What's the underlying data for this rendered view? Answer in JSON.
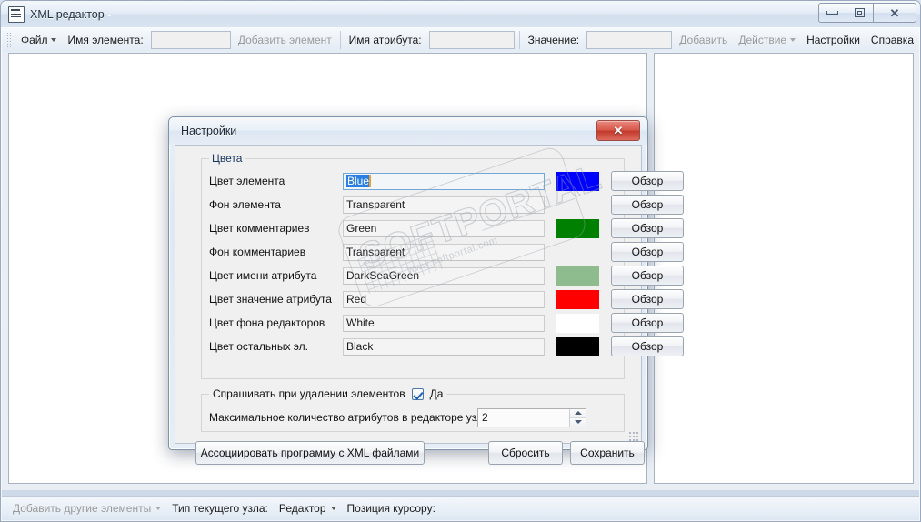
{
  "window": {
    "title": "XML редактор -",
    "icon": "xml-file-icon",
    "buttons": {
      "minimize": "minimize-icon",
      "maximize": "maximize-icon",
      "close": "✕"
    }
  },
  "toolbar": {
    "file_menu": "Файл",
    "element_name_label": "Имя элемента:",
    "element_name_value": "",
    "add_element": "Добавить элемент",
    "attribute_name_label": "Имя атрибута:",
    "attribute_name_value": "",
    "value_label": "Значение:",
    "value_value": "",
    "add": "Добавить",
    "action": "Действие",
    "settings": "Настройки",
    "help": "Справка"
  },
  "statusbar": {
    "add_other_elements": "Добавить другие элементы",
    "current_node_type_label": "Тип текущего узла:",
    "editor": "Редактор",
    "cursor_position_label": "Позиция курсору:"
  },
  "dialog": {
    "title": "Настройки",
    "close_label": "✕",
    "colors_group_legend": "Цвета",
    "browse_label": "Обзор",
    "rows": [
      {
        "label": "Цвет элемента",
        "value": "Blue",
        "swatch": "#0000ff",
        "transparent": false,
        "focused": true
      },
      {
        "label": "Фон элемента",
        "value": "Transparent",
        "swatch": "",
        "transparent": true,
        "focused": false
      },
      {
        "label": "Цвет комментариев",
        "value": "Green",
        "swatch": "#008000",
        "transparent": false,
        "focused": false
      },
      {
        "label": "Фон комментариев",
        "value": "Transparent",
        "swatch": "",
        "transparent": true,
        "focused": false
      },
      {
        "label": "Цвет имени атрибута",
        "value": "DarkSeaGreen",
        "swatch": "#8fbc8f",
        "transparent": false,
        "focused": false
      },
      {
        "label": "Цвет значение атрибута",
        "value": "Red",
        "swatch": "#ff0000",
        "transparent": false,
        "focused": false
      },
      {
        "label": "Цвет фона редакторов",
        "value": "White",
        "swatch": "#ffffff",
        "transparent": false,
        "focused": false
      },
      {
        "label": "Цвет остальных эл.",
        "value": "Black",
        "swatch": "#000000",
        "transparent": false,
        "focused": false
      }
    ],
    "confirm_delete_label": "Спрашивать при удалении элементов",
    "confirm_delete_yes": "Да",
    "confirm_delete_checked": true,
    "max_attributes_label": "Максимальное количество атрибутов в редакторе узлов",
    "max_attributes_value": "2",
    "associate_button": "Ассоциировать программу с XML файлами",
    "reset_button": "Сбросить",
    "save_button": "Сохранить"
  },
  "watermark": {
    "text": "SOFTPORTAL",
    "url": "www.softportal.com"
  }
}
